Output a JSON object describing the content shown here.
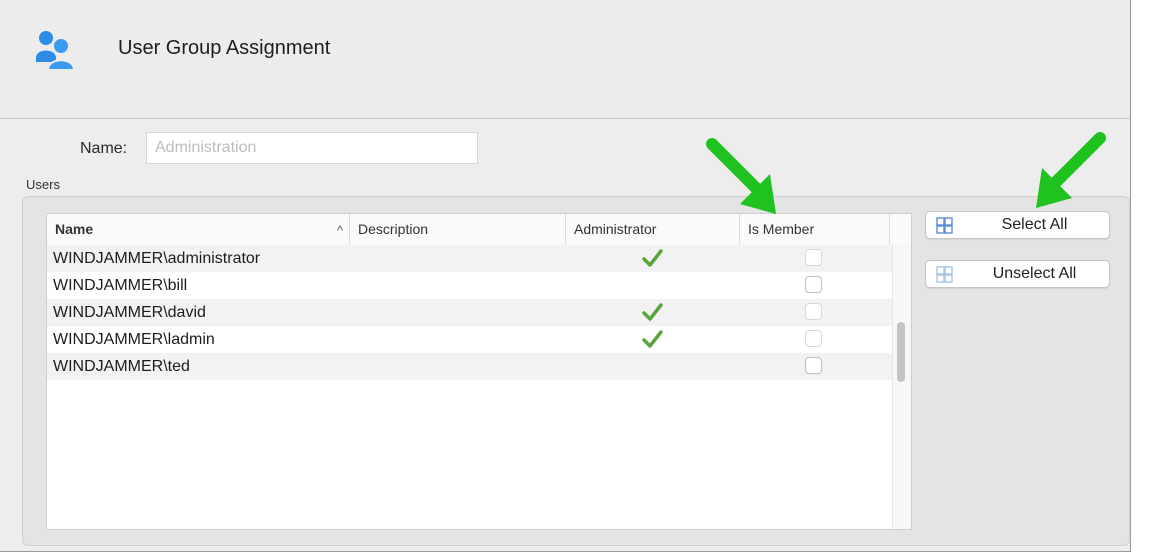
{
  "window": {
    "title": "User Group Assignment",
    "icon": "users-group-icon"
  },
  "form": {
    "name_label": "Name:",
    "name_placeholder": "Administration",
    "users_label": "Users"
  },
  "table": {
    "columns": [
      "Name",
      "Description",
      "Administrator",
      "Is Member"
    ],
    "sort_indicator": "^",
    "rows": [
      {
        "name": "WINDJAMMER\\administrator",
        "description": "",
        "administrator": true,
        "is_member": false
      },
      {
        "name": "WINDJAMMER\\bill",
        "description": "",
        "administrator": false,
        "is_member": false
      },
      {
        "name": "WINDJAMMER\\david",
        "description": "",
        "administrator": true,
        "is_member": false
      },
      {
        "name": "WINDJAMMER\\ladmin",
        "description": "",
        "administrator": true,
        "is_member": false
      },
      {
        "name": "WINDJAMMER\\ted",
        "description": "",
        "administrator": false,
        "is_member": false
      }
    ]
  },
  "buttons": {
    "select_all": "Select All",
    "unselect_all": "Unselect All"
  },
  "colors": {
    "check": "#5aa43c",
    "arrow": "#1fc21f",
    "icon_blue": "#2d8ce6"
  }
}
